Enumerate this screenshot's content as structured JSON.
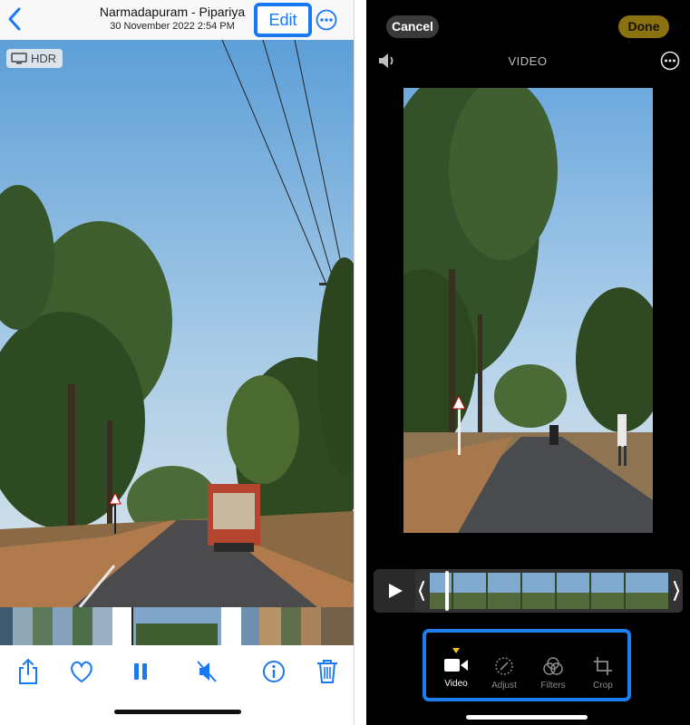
{
  "left": {
    "nav": {
      "title": "Narmadapuram - Pipariya",
      "subtitle": "30 November 2022  2:54 PM",
      "edit_label": "Edit"
    },
    "hdr_label": "HDR",
    "toolbar": [
      "share-icon",
      "heart-icon",
      "pause-icon",
      "mute-icon",
      "info-icon",
      "trash-icon"
    ],
    "colors": {
      "accent": "#1a78f2",
      "highlight_box": "#1778f0"
    }
  },
  "right": {
    "cancel_label": "Cancel",
    "done_label": "Done",
    "mode_label": "VIDEO",
    "tools": {
      "video": "Video",
      "adjust": "Adjust",
      "filters": "Filters",
      "crop": "Crop"
    },
    "active_tool": "Video",
    "colors": {
      "done_bg": "#8a7210",
      "active_marker": "#f2c417",
      "highlight_box": "#1d7ef0"
    }
  }
}
